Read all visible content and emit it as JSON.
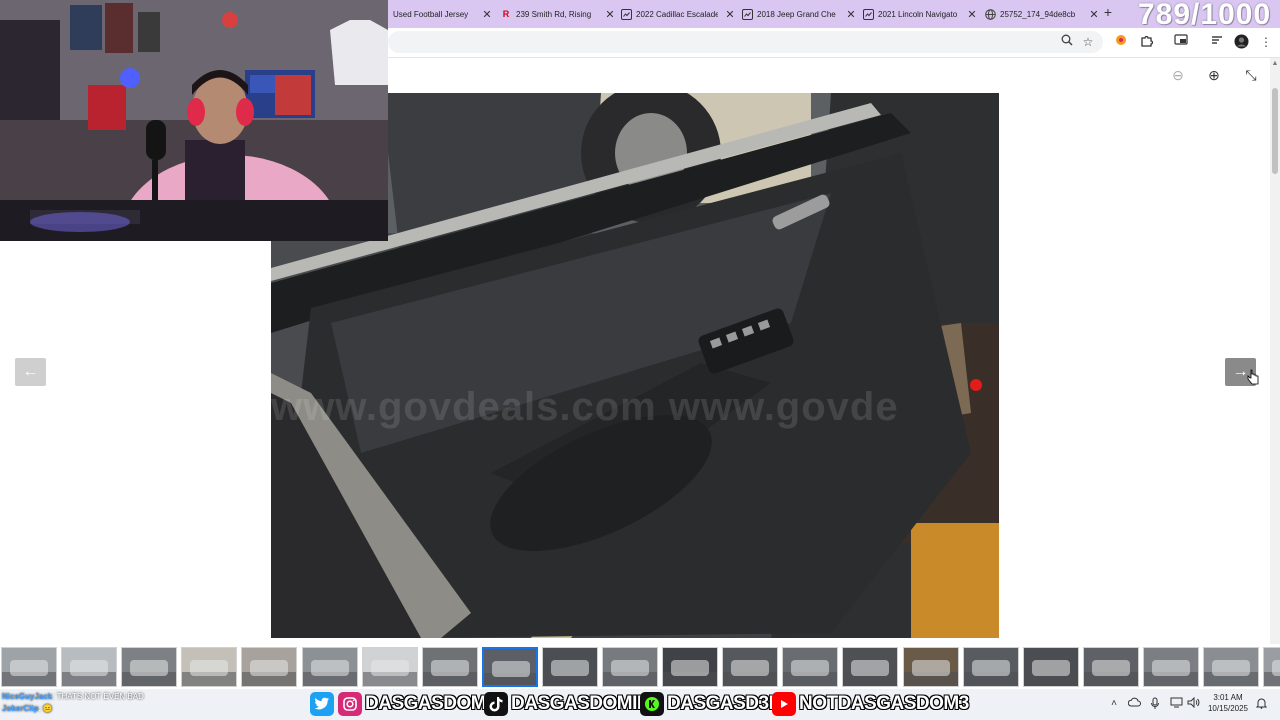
{
  "browser": {
    "counter_overlay": "789/1000",
    "tabs": [
      {
        "title": "Used Football Jersey",
        "icon": "none"
      },
      {
        "title": "239 Smith Rd, Rising",
        "icon": "realtor-r-icon"
      },
      {
        "title": "2022 Cadillac Escalade",
        "icon": "listing-icon"
      },
      {
        "title": "2018 Jeep Grand Che",
        "icon": "listing-icon"
      },
      {
        "title": "2021 Lincoln Navigato",
        "icon": "listing-icon"
      },
      {
        "title": "25752_174_94de8cb",
        "icon": "globe-icon"
      }
    ],
    "tab_close_glyph": "✕",
    "new_tab_glyph": "+",
    "toolbar_icons": [
      "zoom-icon",
      "star-icon",
      "extension-color-icon",
      "extensions-puzzle-icon",
      "cast-icon",
      "reading-list-icon",
      "profile-avatar-icon",
      "kebab-menu-icon"
    ]
  },
  "viewer": {
    "watermark": "www.govdeals.com www.govde",
    "prev_glyph": "←",
    "next_glyph": "→",
    "zoom_out_glyph": "⊖",
    "zoom_in_glyph": "⊕",
    "exit_fullscreen_glyph": "⤡",
    "thumbnail_count": 22,
    "active_thumbnail_index": 8
  },
  "stream": {
    "social": [
      {
        "platform": "twitter",
        "icon_glyph": "🐦",
        "color": "#1da1f2",
        "handle": ""
      },
      {
        "platform": "instagram",
        "icon_glyph": "◎",
        "color": "#d62976",
        "handle": "DASGASDOM3"
      },
      {
        "platform": "tiktok",
        "icon_glyph": "♪",
        "color": "#111111",
        "handle": "DASGASDOMINI"
      },
      {
        "platform": "kick",
        "icon_glyph": "K",
        "color": "#53fc18",
        "handle": "DASGASD3M"
      },
      {
        "platform": "youtube",
        "icon_glyph": "▶",
        "color": "#ff0000",
        "handle": "NOTDASGASDOM3"
      }
    ],
    "chat": [
      {
        "name": "NiceGuyJack",
        "text": "THATS NOT EVEN BAD"
      },
      {
        "name": "JokerClip",
        "text": "😐"
      }
    ]
  },
  "taskbar": {
    "time": "3:01 AM",
    "date": "10/15/2025",
    "tray_icons": [
      "chevron-up-icon",
      "cloud-icon",
      "microphone-icon",
      "network-icon",
      "volume-icon"
    ]
  },
  "colors": {
    "tab_strip": "#d9c7f2",
    "accent": "#1a73e8"
  }
}
